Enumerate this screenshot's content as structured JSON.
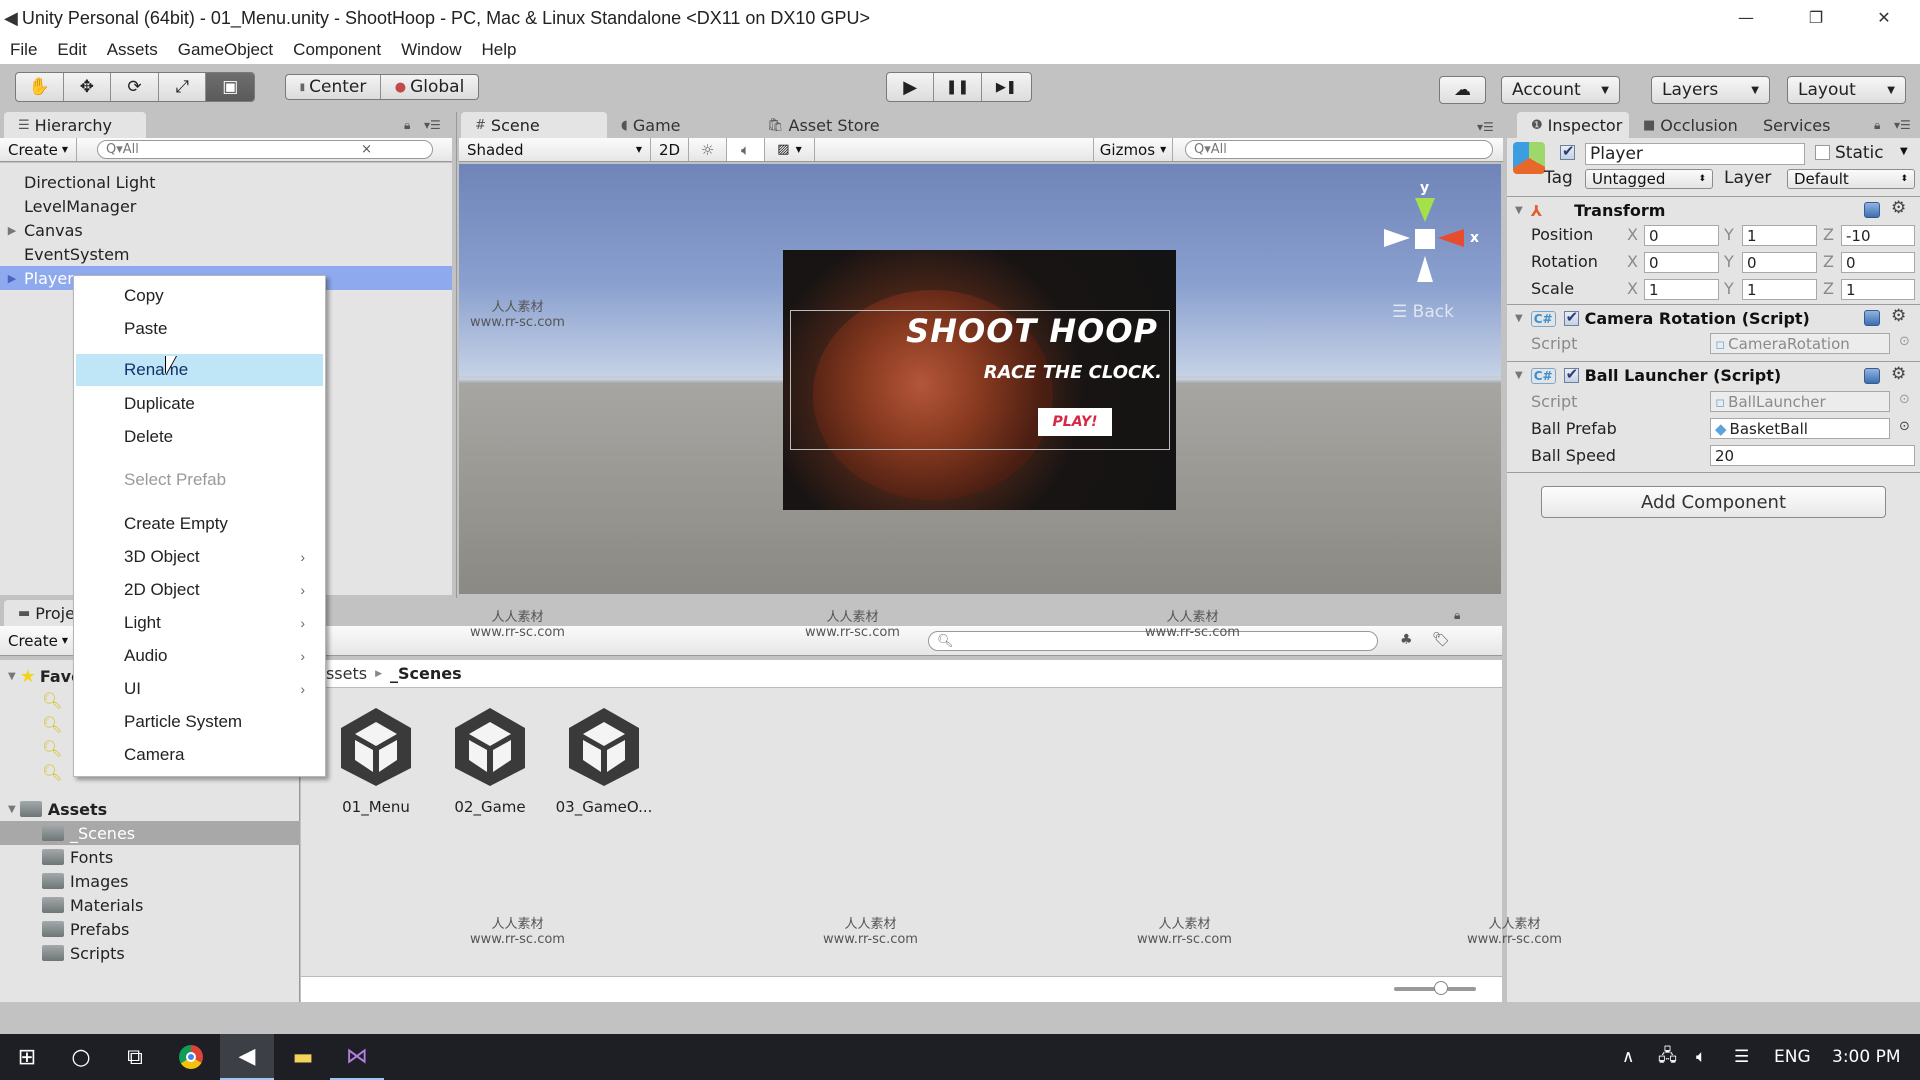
{
  "window": {
    "title": "Unity Personal (64bit) - 01_Menu.unity - ShootHoop - PC, Mac & Linux Standalone <DX11 on DX10 GPU>",
    "minimize": "—",
    "restore": "❐",
    "close": "✕"
  },
  "menubar": [
    "File",
    "Edit",
    "Assets",
    "GameObject",
    "Component",
    "Window",
    "Help"
  ],
  "toolbar": {
    "tools": [
      {
        "name": "hand-tool",
        "glyph": "✋"
      },
      {
        "name": "move-tool",
        "glyph": "✥"
      },
      {
        "name": "rotate-tool",
        "glyph": "⟳"
      },
      {
        "name": "scale-tool",
        "glyph": "⤢"
      },
      {
        "name": "rect-tool",
        "glyph": "▣"
      }
    ],
    "active_tool": 4,
    "pivot": "Center",
    "space": "Global",
    "play": "▶",
    "pause": "❚❚",
    "step": "▶❚",
    "cloud": "☁",
    "account": "Account",
    "layers": "Layers",
    "layout": "Layout"
  },
  "hierarchy": {
    "tab": "Hierarchy",
    "create": "Create",
    "search_placeholder": "Q▾All",
    "items": [
      {
        "label": "Directional Light",
        "expandable": false,
        "selected": false
      },
      {
        "label": "LevelManager",
        "expandable": false,
        "selected": false
      },
      {
        "label": "Canvas",
        "expandable": true,
        "selected": false
      },
      {
        "label": "EventSystem",
        "expandable": false,
        "selected": false
      },
      {
        "label": "Player",
        "expandable": true,
        "selected": true
      }
    ]
  },
  "context_menu": {
    "items": [
      {
        "label": "Copy"
      },
      {
        "label": "Paste"
      },
      {
        "label": "Rename",
        "highlighted": true
      },
      {
        "label": "Duplicate"
      },
      {
        "label": "Delete"
      },
      {
        "label": "Select Prefab",
        "disabled": true
      },
      {
        "label": "Create Empty"
      },
      {
        "label": "3D Object",
        "submenu": true
      },
      {
        "label": "2D Object",
        "submenu": true
      },
      {
        "label": "Light",
        "submenu": true
      },
      {
        "label": "Audio",
        "submenu": true
      },
      {
        "label": "UI",
        "submenu": true
      },
      {
        "label": "Particle System"
      },
      {
        "label": "Camera"
      }
    ]
  },
  "scene": {
    "tabs": [
      "Scene",
      "Game",
      "Asset Store"
    ],
    "shading": "Shaded",
    "mode_2d": "2D",
    "gizmos": "Gizmos",
    "search_placeholder": "Q▾All",
    "canvas_title": "SHOOT HOOP",
    "canvas_subtitle": "RACE THE CLOCK.",
    "canvas_button": "PLAY!",
    "gizmo_y": "y",
    "gizmo_x": "x",
    "view_label": "Back"
  },
  "inspector": {
    "tabs": [
      "Inspector",
      "Occlusion",
      "Services"
    ],
    "object_name": "Player",
    "active": true,
    "static_label": "Static",
    "static": false,
    "tag_label": "Tag",
    "tag": "Untagged",
    "layer_label": "Layer",
    "layer": "Default",
    "transform": {
      "title": "Transform",
      "rows": [
        {
          "label": "Position",
          "x": "0",
          "y": "1",
          "z": "-10"
        },
        {
          "label": "Rotation",
          "x": "0",
          "y": "0",
          "z": "0"
        },
        {
          "label": "Scale",
          "x": "1",
          "y": "1",
          "z": "1"
        }
      ]
    },
    "camera_rotation": {
      "title": "Camera Rotation (Script)",
      "enabled": true,
      "script_label": "Script",
      "script": "CameraRotation"
    },
    "ball_launcher": {
      "title": "Ball Launcher (Script)",
      "enabled": true,
      "script_label": "Script",
      "script": "BallLauncher",
      "prefab_label": "Ball Prefab",
      "prefab": "BasketBall",
      "speed_label": "Ball Speed",
      "speed": "20"
    },
    "add_component": "Add Component"
  },
  "project": {
    "tab": "Project",
    "create": "Create",
    "favorites_label": "Favorites",
    "assets_label": "Assets",
    "folders": [
      "_Scenes",
      "Fonts",
      "Images",
      "Materials",
      "Prefabs",
      "Scripts"
    ],
    "selected_folder": "_Scenes",
    "breadcrumb": [
      "Assets",
      "_Scenes"
    ],
    "files": [
      "01_Menu",
      "02_Game",
      "03_GameO..."
    ]
  },
  "taskbar": {
    "lang": "ENG",
    "time": "3:00 PM"
  },
  "watermark": {
    "cn": "人人素材",
    "url": "www.rr-sc.com"
  }
}
